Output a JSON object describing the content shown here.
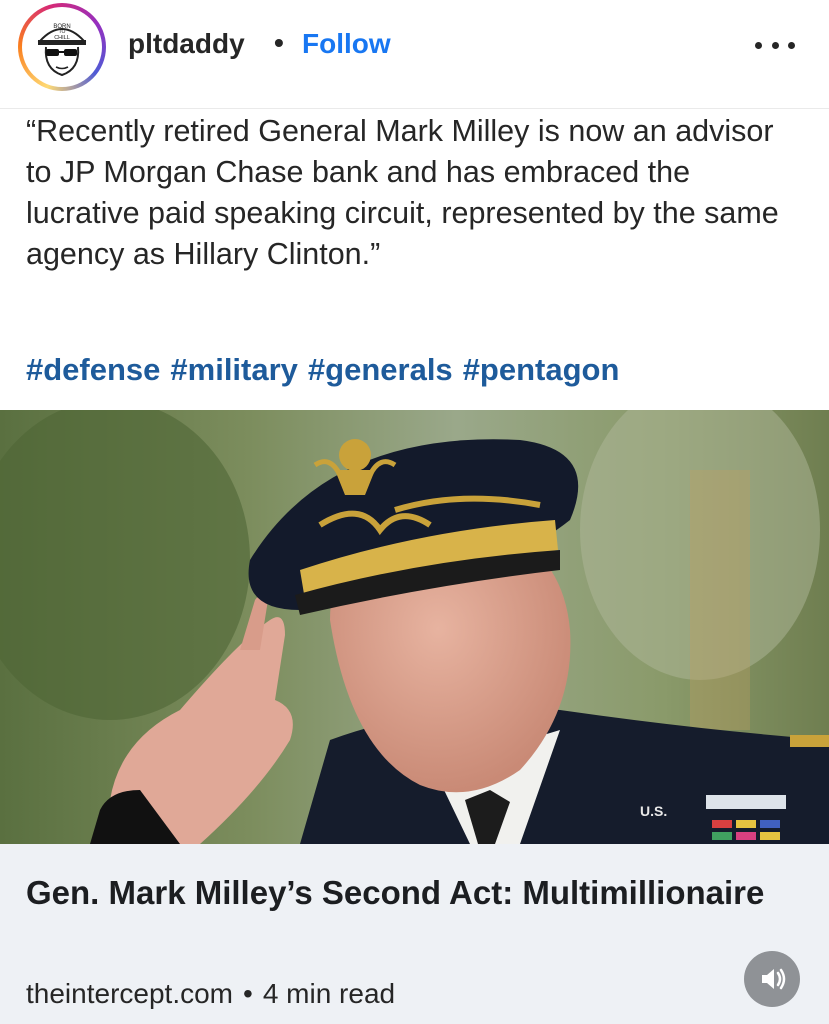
{
  "header": {
    "avatar_text": [
      "BORN",
      "TO",
      "CHILL"
    ],
    "username": "pltdaddy",
    "separator": "•",
    "follow_label": "Follow"
  },
  "post": {
    "caption": "“Recently retired General Mark Milley is now an advisor to JP Morgan Chase bank and has embraced the lucrative paid speaking circuit, represented by the same agency as Hillary Clinton.”",
    "hashtags": [
      "#defense",
      "#military",
      "#generals",
      "#pentagon"
    ]
  },
  "photo": {
    "uniform_label": "U.S."
  },
  "link_preview": {
    "title": "Gen. Mark Milley’s Second Act: Multimillionaire",
    "source": "theintercept.com",
    "separator": "•",
    "read_time": "4 min read"
  },
  "icons": {
    "more": "more-options-icon",
    "sound": "speaker-icon"
  },
  "colors": {
    "follow": "#1877f2",
    "hashtag": "#1e5b9b",
    "card_bg": "#eef1f5"
  }
}
